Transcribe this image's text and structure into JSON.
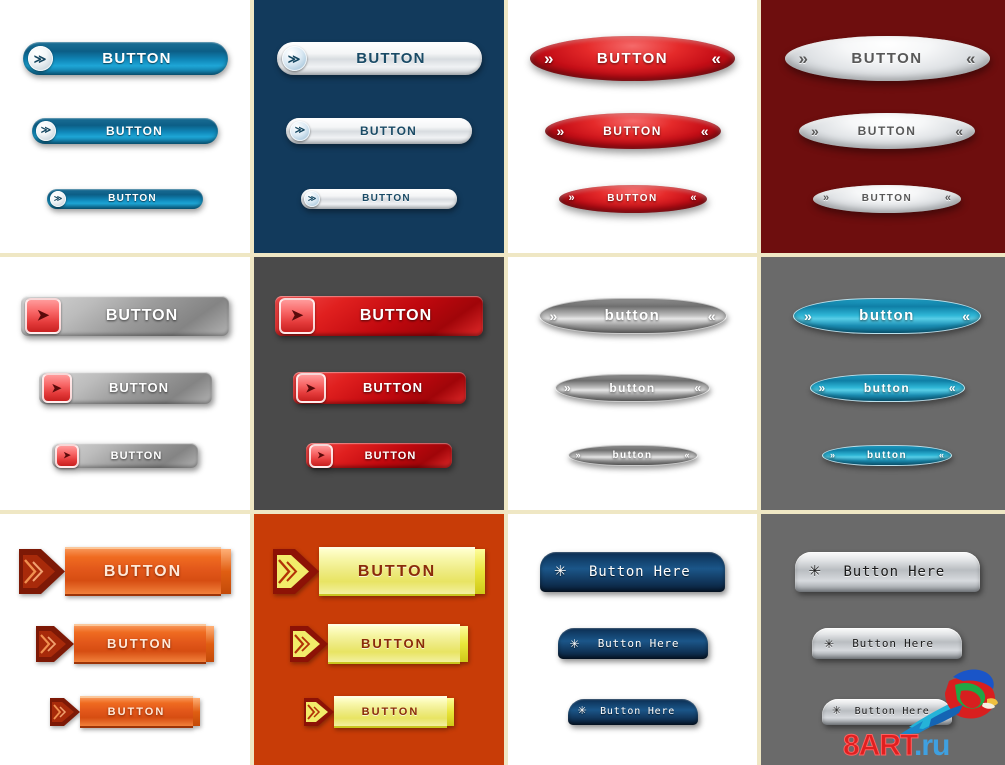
{
  "sheet": {
    "title": "Web Button Set Preview Sheet",
    "columns": 4,
    "rows": 3,
    "divider_color": "#EFE7C4"
  },
  "watermark": {
    "name": "8art-watermark",
    "text_primary": "8ART",
    "text_suffix": ".ru",
    "primary_color": "#E02020",
    "suffix_color": "#3FA0E0",
    "bird_icon": "parrot-icon"
  },
  "cells": [
    {
      "id": "cell-1",
      "name": "blue-pill-on-white",
      "background": "#FFFFFF",
      "style": "pill",
      "accent": "#0D6D98",
      "icon": "chevron-right-badge-icon",
      "icon_glyph": "≫",
      "buttons": [
        {
          "label": "BUTTON",
          "size": "large"
        },
        {
          "label": "BUTTON",
          "size": "medium"
        },
        {
          "label": "BUTTON",
          "size": "small"
        }
      ]
    },
    {
      "id": "cell-2",
      "name": "silver-pill-on-navy",
      "background": "#123A5C",
      "style": "pill",
      "accent": "#1A4B66",
      "icon": "chevron-right-badge-icon",
      "icon_glyph": "≫",
      "buttons": [
        {
          "label": "BUTTON",
          "size": "large"
        },
        {
          "label": "BUTTON",
          "size": "medium"
        },
        {
          "label": "BUTTON",
          "size": "small"
        }
      ]
    },
    {
      "id": "cell-3",
      "name": "red-ellipse-on-white",
      "background": "#FFFFFF",
      "style": "ellipse",
      "accent": "#C40D16",
      "icon_left": "chevron-double-right-icon",
      "icon_right": "chevron-double-left-icon",
      "glyph_left": "»",
      "glyph_right": "«",
      "buttons": [
        {
          "label": "BUTTON",
          "size": "large"
        },
        {
          "label": "BUTTON",
          "size": "medium"
        },
        {
          "label": "BUTTON",
          "size": "small"
        }
      ]
    },
    {
      "id": "cell-4",
      "name": "silver-ellipse-on-dark-red",
      "background": "#6E0E0E",
      "style": "ellipse",
      "accent": "#585858",
      "icon_left": "chevron-double-right-icon",
      "icon_right": "chevron-double-left-icon",
      "glyph_left": "»",
      "glyph_right": "«",
      "buttons": [
        {
          "label": "BUTTON",
          "size": "large"
        },
        {
          "label": "BUTTON",
          "size": "medium"
        },
        {
          "label": "BUTTON",
          "size": "small"
        }
      ]
    },
    {
      "id": "cell-5",
      "name": "grey-rect-on-white",
      "background": "#FFFFFF",
      "style": "rect",
      "accent": "#9A9A9A",
      "icon": "red-square-arrow-icon",
      "icon_glyph": "➤",
      "buttons": [
        {
          "label": "BUTTON",
          "size": "large"
        },
        {
          "label": "BUTTON",
          "size": "medium"
        },
        {
          "label": "BUTTON",
          "size": "small"
        }
      ]
    },
    {
      "id": "cell-6",
      "name": "red-rect-on-dark-grey",
      "background": "#4A4A4A",
      "style": "rect",
      "accent": "#C0080E",
      "icon": "red-square-arrow-icon",
      "icon_glyph": "➤",
      "buttons": [
        {
          "label": "BUTTON",
          "size": "large"
        },
        {
          "label": "BUTTON",
          "size": "medium"
        },
        {
          "label": "BUTTON",
          "size": "small"
        }
      ]
    },
    {
      "id": "cell-7",
      "name": "grey-lens-on-white",
      "background": "#FFFFFF",
      "style": "lens",
      "accent": "#8F8F8F",
      "icon_left": "chevron-double-right-icon",
      "icon_right": "chevron-double-left-icon",
      "glyph_left": "»",
      "glyph_right": "«",
      "buttons": [
        {
          "label": "button",
          "size": "large"
        },
        {
          "label": "button",
          "size": "medium"
        },
        {
          "label": "button",
          "size": "small"
        }
      ]
    },
    {
      "id": "cell-8",
      "name": "cyan-lens-on-grey",
      "background": "#6A6A6A",
      "style": "lens",
      "accent": "#1F9EC4",
      "icon_left": "chevron-double-right-icon",
      "icon_right": "chevron-double-left-icon",
      "glyph_left": "»",
      "glyph_right": "«",
      "buttons": [
        {
          "label": "button",
          "size": "large"
        },
        {
          "label": "button",
          "size": "medium"
        },
        {
          "label": "button",
          "size": "small"
        }
      ]
    },
    {
      "id": "cell-9",
      "name": "orange-arrow-banner-on-white",
      "background": "#FFFFFF",
      "style": "banner",
      "accent": "#E2571A",
      "icon": "double-arrow-head-icon",
      "buttons": [
        {
          "label": "BUTTON",
          "size": "large"
        },
        {
          "label": "BUTTON",
          "size": "medium"
        },
        {
          "label": "BUTTON",
          "size": "small"
        }
      ]
    },
    {
      "id": "cell-10",
      "name": "yellow-arrow-banner-on-rust",
      "background": "#C83C07",
      "style": "banner",
      "accent": "#EEEB84",
      "icon": "double-arrow-head-icon",
      "buttons": [
        {
          "label": "BUTTON",
          "size": "large"
        },
        {
          "label": "BUTTON",
          "size": "medium"
        },
        {
          "label": "BUTTON",
          "size": "small"
        }
      ]
    },
    {
      "id": "cell-11",
      "name": "navy-dome-on-white",
      "background": "#FFFFFF",
      "style": "dome",
      "accent": "#1B5689",
      "icon": "sparkle-arrow-icon",
      "icon_glyph": "✳",
      "buttons": [
        {
          "label": "Button Here",
          "size": "large"
        },
        {
          "label": "Button Here",
          "size": "medium"
        },
        {
          "label": "Button Here",
          "size": "small"
        }
      ]
    },
    {
      "id": "cell-12",
      "name": "silver-dome-on-grey",
      "background": "#6A6A6A",
      "style": "dome",
      "accent": "#B9BDC1",
      "icon": "sparkle-arrow-icon",
      "icon_glyph": "✳",
      "buttons": [
        {
          "label": "Button Here",
          "size": "large"
        },
        {
          "label": "Button Here",
          "size": "medium"
        },
        {
          "label": "Button Here",
          "size": "small"
        }
      ]
    }
  ]
}
